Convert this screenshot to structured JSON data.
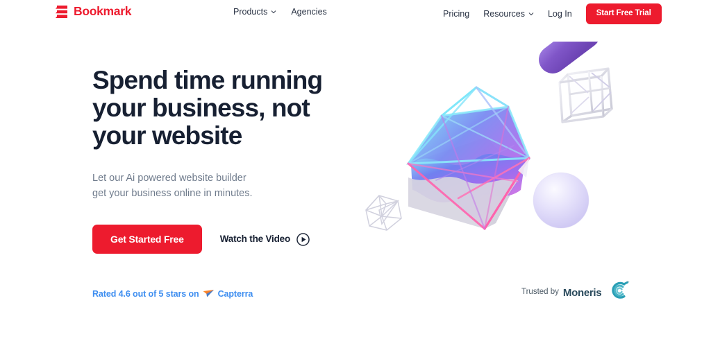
{
  "brand": {
    "name": "Bookmark",
    "icon": "bookmark-logo-icon",
    "color": "#ed1b2e"
  },
  "nav": {
    "left_items": [
      {
        "label": "Products",
        "has_dropdown": true,
        "icon": "chevron-down-icon"
      },
      {
        "label": "Agencies",
        "has_dropdown": false
      }
    ],
    "right_items": [
      {
        "label": "Pricing",
        "has_dropdown": false
      },
      {
        "label": "Resources",
        "has_dropdown": true,
        "icon": "chevron-down-icon"
      },
      {
        "label": "Log In",
        "has_dropdown": false
      }
    ],
    "cta_label": "Start Free Trial"
  },
  "hero": {
    "headline": "Spend time running\nyour business, not\nyour website",
    "subheadline": "Let our Ai powered website builder\nget your business online in minutes.",
    "primary_button": "Get Started Free",
    "video_link": "Watch the Video",
    "video_icon": "play-circle-icon"
  },
  "rating": {
    "text_before": "Rated 4.6 out of 5 stars on",
    "score": "4.6",
    "max": "5",
    "platform": "Capterra",
    "icon": "capterra-logo-icon",
    "color": "#3e8ef0"
  },
  "trusted": {
    "prefix": "Trusted by",
    "brand": "Moneris",
    "icon": "moneris-logo-icon",
    "color": "#2a9fb5"
  },
  "artwork": {
    "name": "3d-abstract-shapes-illustration",
    "shapes": [
      {
        "name": "gradient-gem",
        "colors": [
          "#6fe5f5",
          "#ff5fa8",
          "#8b6ff0",
          "#d4d2de"
        ]
      },
      {
        "name": "purple-capsule",
        "colors": [
          "#7c4fc0",
          "#9a72d8"
        ]
      },
      {
        "name": "wireframe-cube",
        "colors": [
          "#dcdce8"
        ]
      },
      {
        "name": "wireframe-icosahedron",
        "colors": [
          "#dcdce8"
        ]
      },
      {
        "name": "lavender-sphere",
        "colors": [
          "#d6d2f5",
          "#f2f0fd"
        ]
      }
    ]
  }
}
